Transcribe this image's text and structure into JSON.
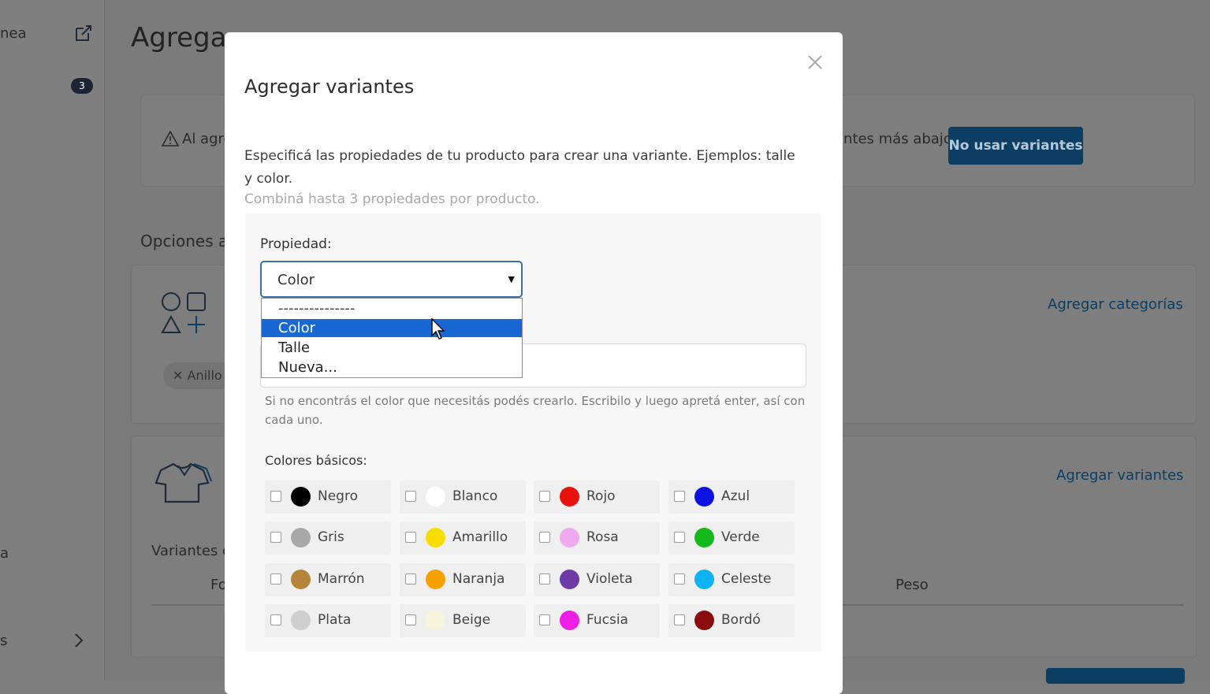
{
  "sidebar": {
    "item_partial": "nea",
    "badge": "3",
    "item2_partial": "a",
    "item3_partial": "s"
  },
  "background": {
    "page_title": "Agrega",
    "warning_left": "Al agre",
    "warning_right": "ntes más abajo.",
    "no_variants_button": "No usar variantes",
    "options_heading": "Opciones a",
    "add_categories_link": "Agregar categorías",
    "chip_label": "Anillo",
    "add_variants_link": "Agregar variantes",
    "variants_heading": "Variantes c",
    "col_photo_partial": "Fo",
    "col_weight": "Peso"
  },
  "modal": {
    "title": "Agregar variantes",
    "description": "Especificá las propiedades de tu producto para crear una variante. Ejemplos: talle y color.",
    "hint": "Combiná hasta 3 propiedades por producto.",
    "property_label": "Propiedad:",
    "select_value": "Color",
    "dropdown_options": [
      "---------------",
      "Color",
      "Talle",
      "Nueva..."
    ],
    "help_text": "Si no encontrás el color que necesitás podés crearlo. Escribilo y luego apretá enter, así con cada uno.",
    "basic_colors_label": "Colores básicos:",
    "colors": [
      {
        "name": "Negro",
        "hex": "#000000"
      },
      {
        "name": "Blanco",
        "hex": "#ffffff"
      },
      {
        "name": "Rojo",
        "hex": "#e8120c"
      },
      {
        "name": "Azul",
        "hex": "#0c12e0"
      },
      {
        "name": "Gris",
        "hex": "#a8a8a8"
      },
      {
        "name": "Amarillo",
        "hex": "#f7de00"
      },
      {
        "name": "Rosa",
        "hex": "#efaaef"
      },
      {
        "name": "Verde",
        "hex": "#13b81a"
      },
      {
        "name": "Marrón",
        "hex": "#b7843c"
      },
      {
        "name": "Naranja",
        "hex": "#f6a100"
      },
      {
        "name": "Violeta",
        "hex": "#6e3aa8"
      },
      {
        "name": "Celeste",
        "hex": "#0db2f2"
      },
      {
        "name": "Plata",
        "hex": "#cfcfcf"
      },
      {
        "name": "Beige",
        "hex": "#f5f5dc"
      },
      {
        "name": "Fucsia",
        "hex": "#ef1ee5"
      },
      {
        "name": "Bordó",
        "hex": "#8a0d0d"
      }
    ]
  },
  "accent_color": "#1967d2"
}
